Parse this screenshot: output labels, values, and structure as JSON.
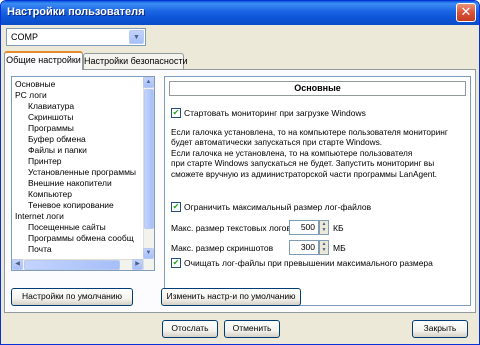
{
  "window": {
    "title": "Настройки пользователя"
  },
  "user_select": {
    "value": "COMP"
  },
  "tabs": [
    {
      "label": "Общие настройки",
      "active": true
    },
    {
      "label": "Настройки безопасности",
      "active": false
    }
  ],
  "tree": {
    "items": [
      {
        "label": "Основные",
        "level": 0,
        "selected": false
      },
      {
        "label": "PC логи",
        "level": 0,
        "selected": false
      },
      {
        "label": "Клавиатура",
        "level": 1,
        "selected": false
      },
      {
        "label": "Скриншоты",
        "level": 1,
        "selected": false
      },
      {
        "label": "Программы",
        "level": 1,
        "selected": false
      },
      {
        "label": "Буфер обмена",
        "level": 1,
        "selected": false
      },
      {
        "label": "Файлы и папки",
        "level": 1,
        "selected": false
      },
      {
        "label": "Принтер",
        "level": 1,
        "selected": false
      },
      {
        "label": "Установленные программы",
        "level": 1,
        "selected": false
      },
      {
        "label": "Внешние накопители",
        "level": 1,
        "selected": false
      },
      {
        "label": "Компьютер",
        "level": 1,
        "selected": false
      },
      {
        "label": "Теневое копирование",
        "level": 1,
        "selected": false
      },
      {
        "label": "Internet логи",
        "level": 0,
        "selected": false
      },
      {
        "label": "Посещенные сайты",
        "level": 1,
        "selected": false
      },
      {
        "label": "Программы обмена сообщ",
        "level": 1,
        "selected": false
      },
      {
        "label": "Почта",
        "level": 1,
        "selected": false
      }
    ]
  },
  "main": {
    "section_title": "Основные",
    "start_monitoring": {
      "label": "Стартовать мониторинг при загрузке Windows",
      "checked": true
    },
    "description_lines": [
      "Если галочка установлена, то на компьютере пользователя мониторинг",
      "будет автоматически запускаться при старте Windows.",
      "Если галочка не установлена, то на компьютере пользователя",
      "при старте Windows запускаться не будет. Запустить мониторинг вы",
      "сможете вручную из администраторской части программы LanAgent."
    ],
    "limit_logs": {
      "label": "Ограничить максимальный размер лог-файлов",
      "checked": true
    },
    "text_logs": {
      "label": "Макс. размер текстовых логов",
      "value": "500",
      "unit": "КБ"
    },
    "screenshots": {
      "label": "Макс. размер скриншотов",
      "value": "300",
      "unit": "МБ"
    },
    "clear_logs": {
      "label": "Очищать лог-файлы при превышении максимального размера",
      "checked": true
    }
  },
  "buttons": {
    "defaults": "Настройки по умолчанию",
    "change_defaults": "Изменить настр-и по умолчанию",
    "send": "Отослать",
    "cancel": "Отменить",
    "close": "Закрыть"
  },
  "colors": {
    "title_bar": "#0a5bd6",
    "window_bg": "#ece9d8",
    "active_tab_accent": "#e68b2c",
    "checkmark": "#21a121"
  }
}
